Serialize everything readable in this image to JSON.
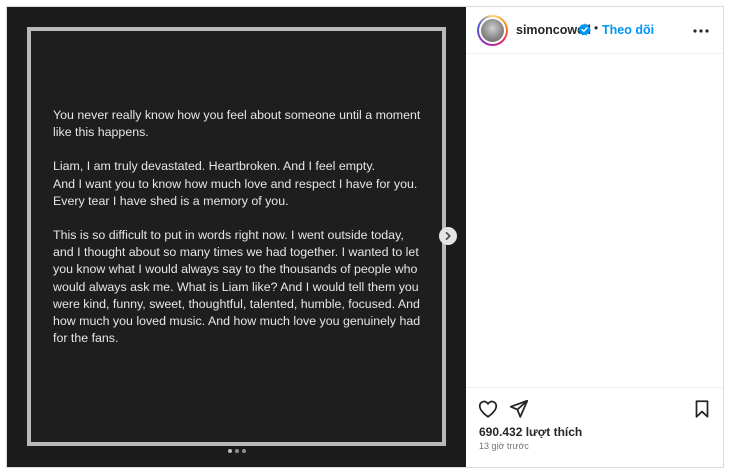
{
  "post": {
    "paragraphs": [
      "You never really know how you feel about someone until a moment like this happens.",
      "Liam, I am truly devastated. Heartbroken. And I feel empty.\nAnd I want you to know how much love and respect I have for you.\nEvery tear I have shed is a memory of you.",
      "This is so difficult to put in words right now. I went outside today, and I thought about so many times we had together. I wanted to let you know what I would always say to the thousands of people who would always ask me. What is Liam like? And I would tell them you were kind, funny, sweet, thoughtful, talented, humble, focused. And how much you loved music. And how much love you genuinely had for the fans."
    ],
    "carousel_count": 3,
    "carousel_active_index": 1
  },
  "header": {
    "username": "simoncowell",
    "separator": "•",
    "follow_label": "Theo dõi"
  },
  "footer": {
    "likes": "690.432 lượt thích",
    "time": "13 giờ trước"
  },
  "icons": {
    "like": "heart-icon",
    "share": "paper-plane-icon",
    "save": "bookmark-icon",
    "more": "more-horizontal-icon",
    "next": "chevron-right-icon",
    "verified": "verified-badge-icon"
  },
  "colors": {
    "accent": "#0095f6",
    "media_bg": "#1b1b1b",
    "post_border": "#b9b9b9"
  }
}
